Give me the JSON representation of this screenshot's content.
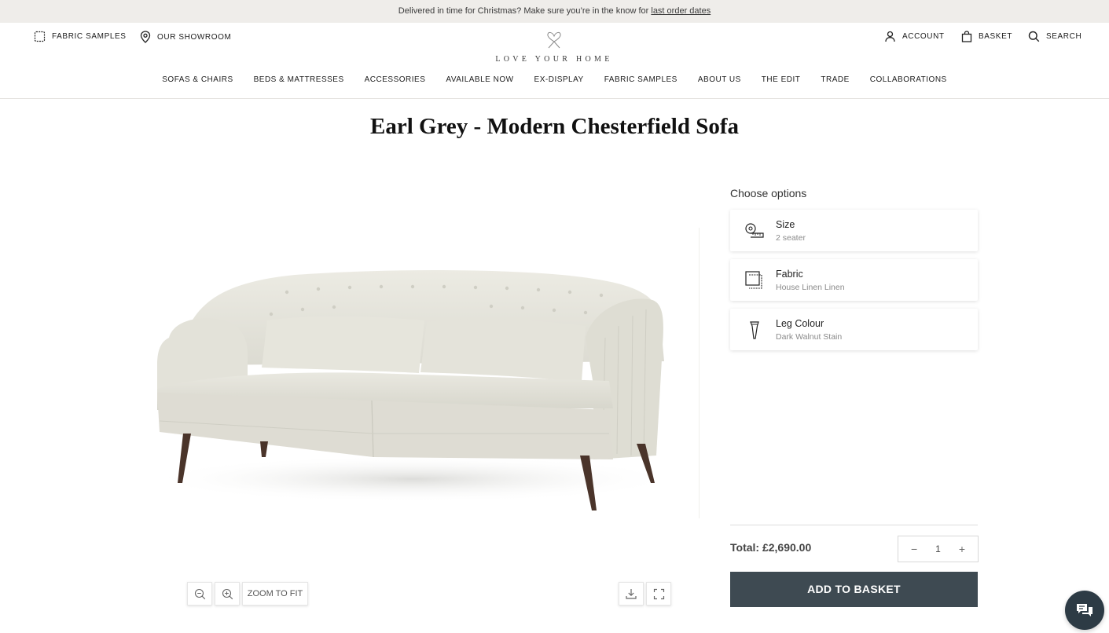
{
  "announcement": {
    "text": "Delivered in time for Christmas? Make sure you’re in the know for ",
    "link": "last order dates"
  },
  "header": {
    "fabric_samples": "FABRIC SAMPLES",
    "showroom": "OUR SHOWROOM",
    "brand": "LOVE YOUR HOME",
    "account": "ACCOUNT",
    "basket": "BASKET",
    "search": "SEARCH"
  },
  "nav": {
    "items": [
      "SOFAS & CHAIRS",
      "BEDS & MATTRESSES",
      "ACCESSORIES",
      "AVAILABLE NOW",
      "EX-DISPLAY",
      "FABRIC SAMPLES",
      "ABOUT US",
      "THE EDIT",
      "TRADE",
      "COLLABORATIONS"
    ]
  },
  "product": {
    "title": "Earl Grey - Modern Chesterfield Sofa",
    "image_alt": "Earl Grey sofa in House Linen Linen"
  },
  "viewer": {
    "zoom_out_icon": "zoom-out-icon",
    "zoom_in_icon": "zoom-in-icon",
    "zoom_fit": "ZOOM TO FIT",
    "download_icon": "download-icon",
    "fullscreen_icon": "fullscreen-icon"
  },
  "options": {
    "heading": "Choose options",
    "items": [
      {
        "label": "Size",
        "value": "2 seater",
        "icon": "tape-measure-icon"
      },
      {
        "label": "Fabric",
        "value": "House Linen Linen",
        "icon": "fabric-swatch-icon"
      },
      {
        "label": "Leg Colour",
        "value": "Dark Walnut Stain",
        "icon": "sofa-leg-icon"
      }
    ]
  },
  "purchase": {
    "total": "Total: £2,690.00",
    "quantity": "1",
    "minus": "−",
    "plus": "+",
    "add_to_basket": "ADD TO BASKET"
  },
  "colors": {
    "accent": "#3e4a52",
    "announcement_bg": "#efedea",
    "fabric": "#e5e4db",
    "legs": "#4a342a"
  }
}
